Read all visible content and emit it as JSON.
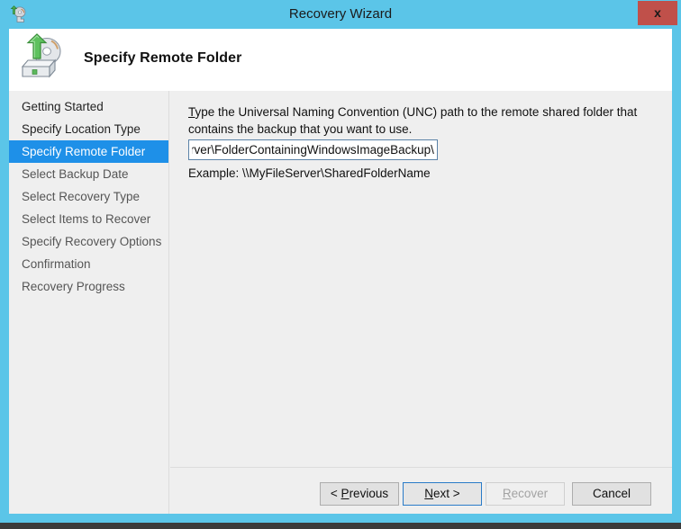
{
  "window": {
    "title": "Recovery Wizard",
    "title_icon": "recovery-disk-icon",
    "close_label": "x",
    "titlebar_color": "#5BC5E8",
    "close_color": "#C0504A"
  },
  "banner": {
    "heading": "Specify Remote Folder",
    "icon": "recovery-drive-icon"
  },
  "sidebar": {
    "items": [
      {
        "label": "Getting Started",
        "state": "done"
      },
      {
        "label": "Specify Location Type",
        "state": "done"
      },
      {
        "label": "Specify Remote Folder",
        "state": "current"
      },
      {
        "label": "Select Backup Date",
        "state": "pending"
      },
      {
        "label": "Select Recovery Type",
        "state": "pending"
      },
      {
        "label": "Select Items to Recover",
        "state": "pending"
      },
      {
        "label": "Specify Recovery Options",
        "state": "pending"
      },
      {
        "label": "Confirmation",
        "state": "pending"
      },
      {
        "label": "Recovery Progress",
        "state": "pending"
      }
    ],
    "highlight_color": "#1E90E8"
  },
  "content": {
    "instruction_accel": "T",
    "instruction_rest": "ype the Universal Naming Convention (UNC) path to the remote shared folder that contains the backup that you want to use.",
    "path_value": "\\\\MyServer\\FolderContainingWindowsImageBackup\\",
    "path_placeholder": "",
    "example": "Example: \\\\MyFileServer\\SharedFolderName"
  },
  "footer": {
    "buttons": [
      {
        "name": "previous",
        "pre": "< ",
        "accel": "P",
        "post": "revious",
        "state": "enabled"
      },
      {
        "name": "next",
        "pre": "",
        "accel": "N",
        "post": "ext >",
        "state": "focused"
      },
      {
        "name": "recover",
        "pre": "",
        "accel": "R",
        "post": "ecover",
        "state": "disabled"
      },
      {
        "name": "cancel",
        "pre": "",
        "accel": "",
        "post": "Cancel",
        "state": "enabled"
      }
    ]
  }
}
